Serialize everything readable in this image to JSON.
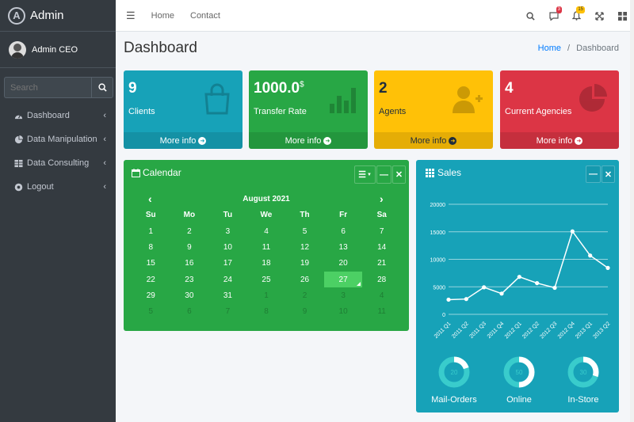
{
  "brand": {
    "name": "Admin",
    "logo_letter": "A"
  },
  "user": {
    "name": "Admin CEO"
  },
  "search": {
    "placeholder": "Search"
  },
  "nav": [
    {
      "label": "Dashboard",
      "icon": "dashboard-icon"
    },
    {
      "label": "Data Manipulation",
      "icon": "pie-chart-icon"
    },
    {
      "label": "Data Consulting",
      "icon": "table-icon"
    },
    {
      "label": "Logout",
      "icon": "logout-icon"
    }
  ],
  "topbar": {
    "links": [
      "Home",
      "Contact"
    ],
    "notifications": {
      "messages": "3",
      "alerts": "15"
    }
  },
  "page": {
    "title": "Dashboard",
    "breadcrumb": {
      "home": "Home",
      "sep": "/",
      "current": "Dashboard"
    }
  },
  "boxes": [
    {
      "value": "9",
      "sup": "",
      "label": "Clients",
      "more": "More info",
      "color": "#17a2b8",
      "icon": "shopping-bag-icon"
    },
    {
      "value": "1000.0",
      "sup": "$",
      "label": "Transfer Rate",
      "more": "More info",
      "color": "#28a745",
      "icon": "bar-chart-icon"
    },
    {
      "value": "2",
      "sup": "",
      "label": "Agents",
      "more": "More info",
      "color": "#ffc107",
      "icon": "user-plus-icon"
    },
    {
      "value": "4",
      "sup": "",
      "label": "Current Agencies",
      "more": "More info",
      "color": "#dc3545",
      "icon": "pie-chart-icon"
    }
  ],
  "calendar": {
    "title": "Calendar",
    "month": "August 2021",
    "days": [
      "Su",
      "Mo",
      "Tu",
      "We",
      "Th",
      "Fr",
      "Sa"
    ],
    "weeks": [
      [
        "1",
        "2",
        "3",
        "4",
        "5",
        "6",
        "7"
      ],
      [
        "8",
        "9",
        "10",
        "11",
        "12",
        "13",
        "14"
      ],
      [
        "15",
        "16",
        "17",
        "18",
        "19",
        "20",
        "21"
      ],
      [
        "22",
        "23",
        "24",
        "25",
        "26",
        "27",
        "28"
      ],
      [
        "29",
        "30",
        "31",
        "1",
        "2",
        "3",
        "4"
      ],
      [
        "5",
        "6",
        "7",
        "8",
        "9",
        "10",
        "11"
      ]
    ],
    "today": "27"
  },
  "sales": {
    "title": "Sales",
    "donuts": [
      {
        "label": "Mail-Orders",
        "value": "20",
        "fraction": 0.2
      },
      {
        "label": "Online",
        "value": "50",
        "fraction": 0.5
      },
      {
        "label": "In-Store",
        "value": "30",
        "fraction": 0.3
      }
    ]
  },
  "chart_data": {
    "type": "line",
    "categories": [
      "2011 Q1",
      "2011 Q2",
      "2011 Q3",
      "2011 Q4",
      "2012 Q1",
      "2012 Q2",
      "2012 Q3",
      "2012 Q4",
      "2013 Q1",
      "2013 Q2"
    ],
    "values": [
      2666,
      2778,
      4912,
      3767,
      6810,
      5670,
      4820,
      15073,
      10687,
      8432
    ],
    "ylim": [
      0,
      20000
    ],
    "yticks": [
      "0",
      "5000",
      "10000",
      "15000",
      "20000"
    ],
    "grid": true
  }
}
